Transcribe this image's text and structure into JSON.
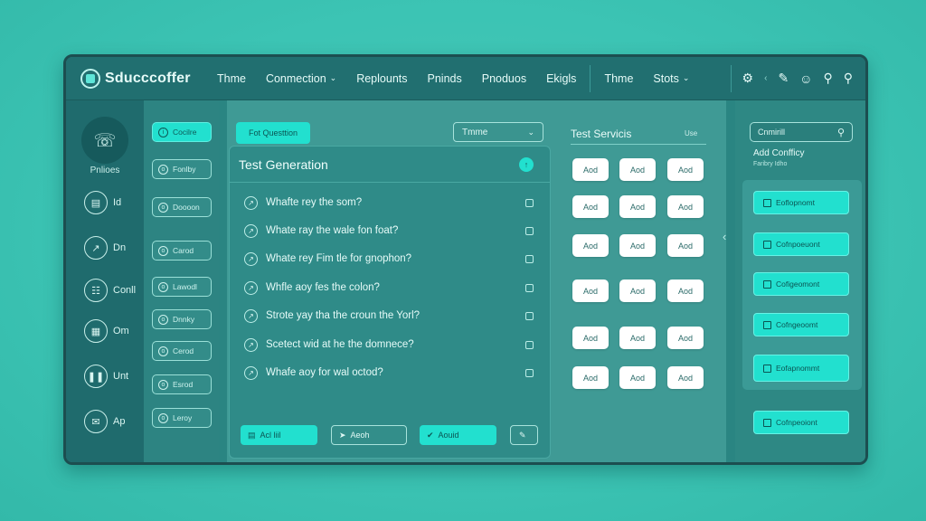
{
  "app": {
    "title": "Sducccoffer"
  },
  "nav": {
    "items": [
      {
        "label": "Thme",
        "chevron": false
      },
      {
        "label": "Conmection",
        "chevron": true
      },
      {
        "label": "Replounts",
        "chevron": false
      },
      {
        "label": "Pninds",
        "chevron": false
      },
      {
        "label": "Pnoduos",
        "chevron": false
      },
      {
        "label": "Ekigls",
        "chevron": false
      },
      {
        "label": "Thme",
        "chevron": false
      },
      {
        "label": "Stots",
        "chevron": true
      }
    ]
  },
  "toolbar_icons": [
    "gear-icon",
    "pencil-icon",
    "face-icon",
    "search-icon",
    "search-icon"
  ],
  "sidebar_icons": {
    "profile_label": "Pnlioes",
    "items": [
      {
        "label": "Id",
        "icon": "id-icon"
      },
      {
        "label": "Dn",
        "icon": "chart-icon"
      },
      {
        "label": "Conll",
        "icon": "book-icon"
      },
      {
        "label": "Om",
        "icon": "doc-icon"
      },
      {
        "label": "Unt",
        "icon": "bars-icon"
      },
      {
        "label": "Ap",
        "icon": "mail-icon"
      }
    ]
  },
  "sidebar_buttons": [
    {
      "label": "Cocilre",
      "active": true
    },
    {
      "label": "Fonlby",
      "active": false
    },
    {
      "label": "Doooon",
      "active": false
    },
    {
      "label": "Carod",
      "active": false
    },
    {
      "label": "Lawodl",
      "active": false
    },
    {
      "label": "Dnnky",
      "active": false
    },
    {
      "label": "Cerod",
      "active": false
    },
    {
      "label": "Esrod",
      "active": false
    },
    {
      "label": "Leroy",
      "active": false
    }
  ],
  "center": {
    "tag_button": "Fot Questtion",
    "theme_select": "Tmme",
    "card": {
      "title": "Test Generation",
      "questions": [
        "Whafte rey the som?",
        "Whate ray the wale fon foat?",
        "Whate rey Fim tle for gnophon?",
        "Whfle aoy fes the colon?",
        "Strote yay tha the croun the Yorl?",
        "Scetect wid at he the domnece?",
        "Whafe aoy for wal octod?"
      ],
      "footer": [
        {
          "label": "Acl liil",
          "style": "cyan"
        },
        {
          "label": "Aeoh",
          "style": "outline"
        },
        {
          "label": "Aouid",
          "style": "cyan"
        },
        {
          "label": "",
          "style": "outline"
        }
      ]
    }
  },
  "test_services": {
    "title": "Test Servicis",
    "more": "Use",
    "buttons": [
      "Aod",
      "Aod",
      "Aod",
      "Aod",
      "Aod",
      "Aod",
      "Aod",
      "Aod",
      "Aod",
      "Aod",
      "Aod",
      "Aod",
      "Aod",
      "Aod",
      "Aod",
      "Aod",
      "Aod",
      "Aod"
    ]
  },
  "right_panel": {
    "search_value": "Cnmirill",
    "add_config_title": "Add Confficy",
    "add_config_sub": "Faribry Idho",
    "configs": [
      "Eoflopnomt",
      "Cofnpoeuont",
      "Cofigeomont",
      "Cofngeoomt",
      "Eofapnommt",
      "Cofnpeoiont"
    ]
  },
  "colors": {
    "background": "#3cc4b4",
    "window": "#2a8582",
    "accent": "#22e0cf",
    "button_white": "#ffffff"
  }
}
